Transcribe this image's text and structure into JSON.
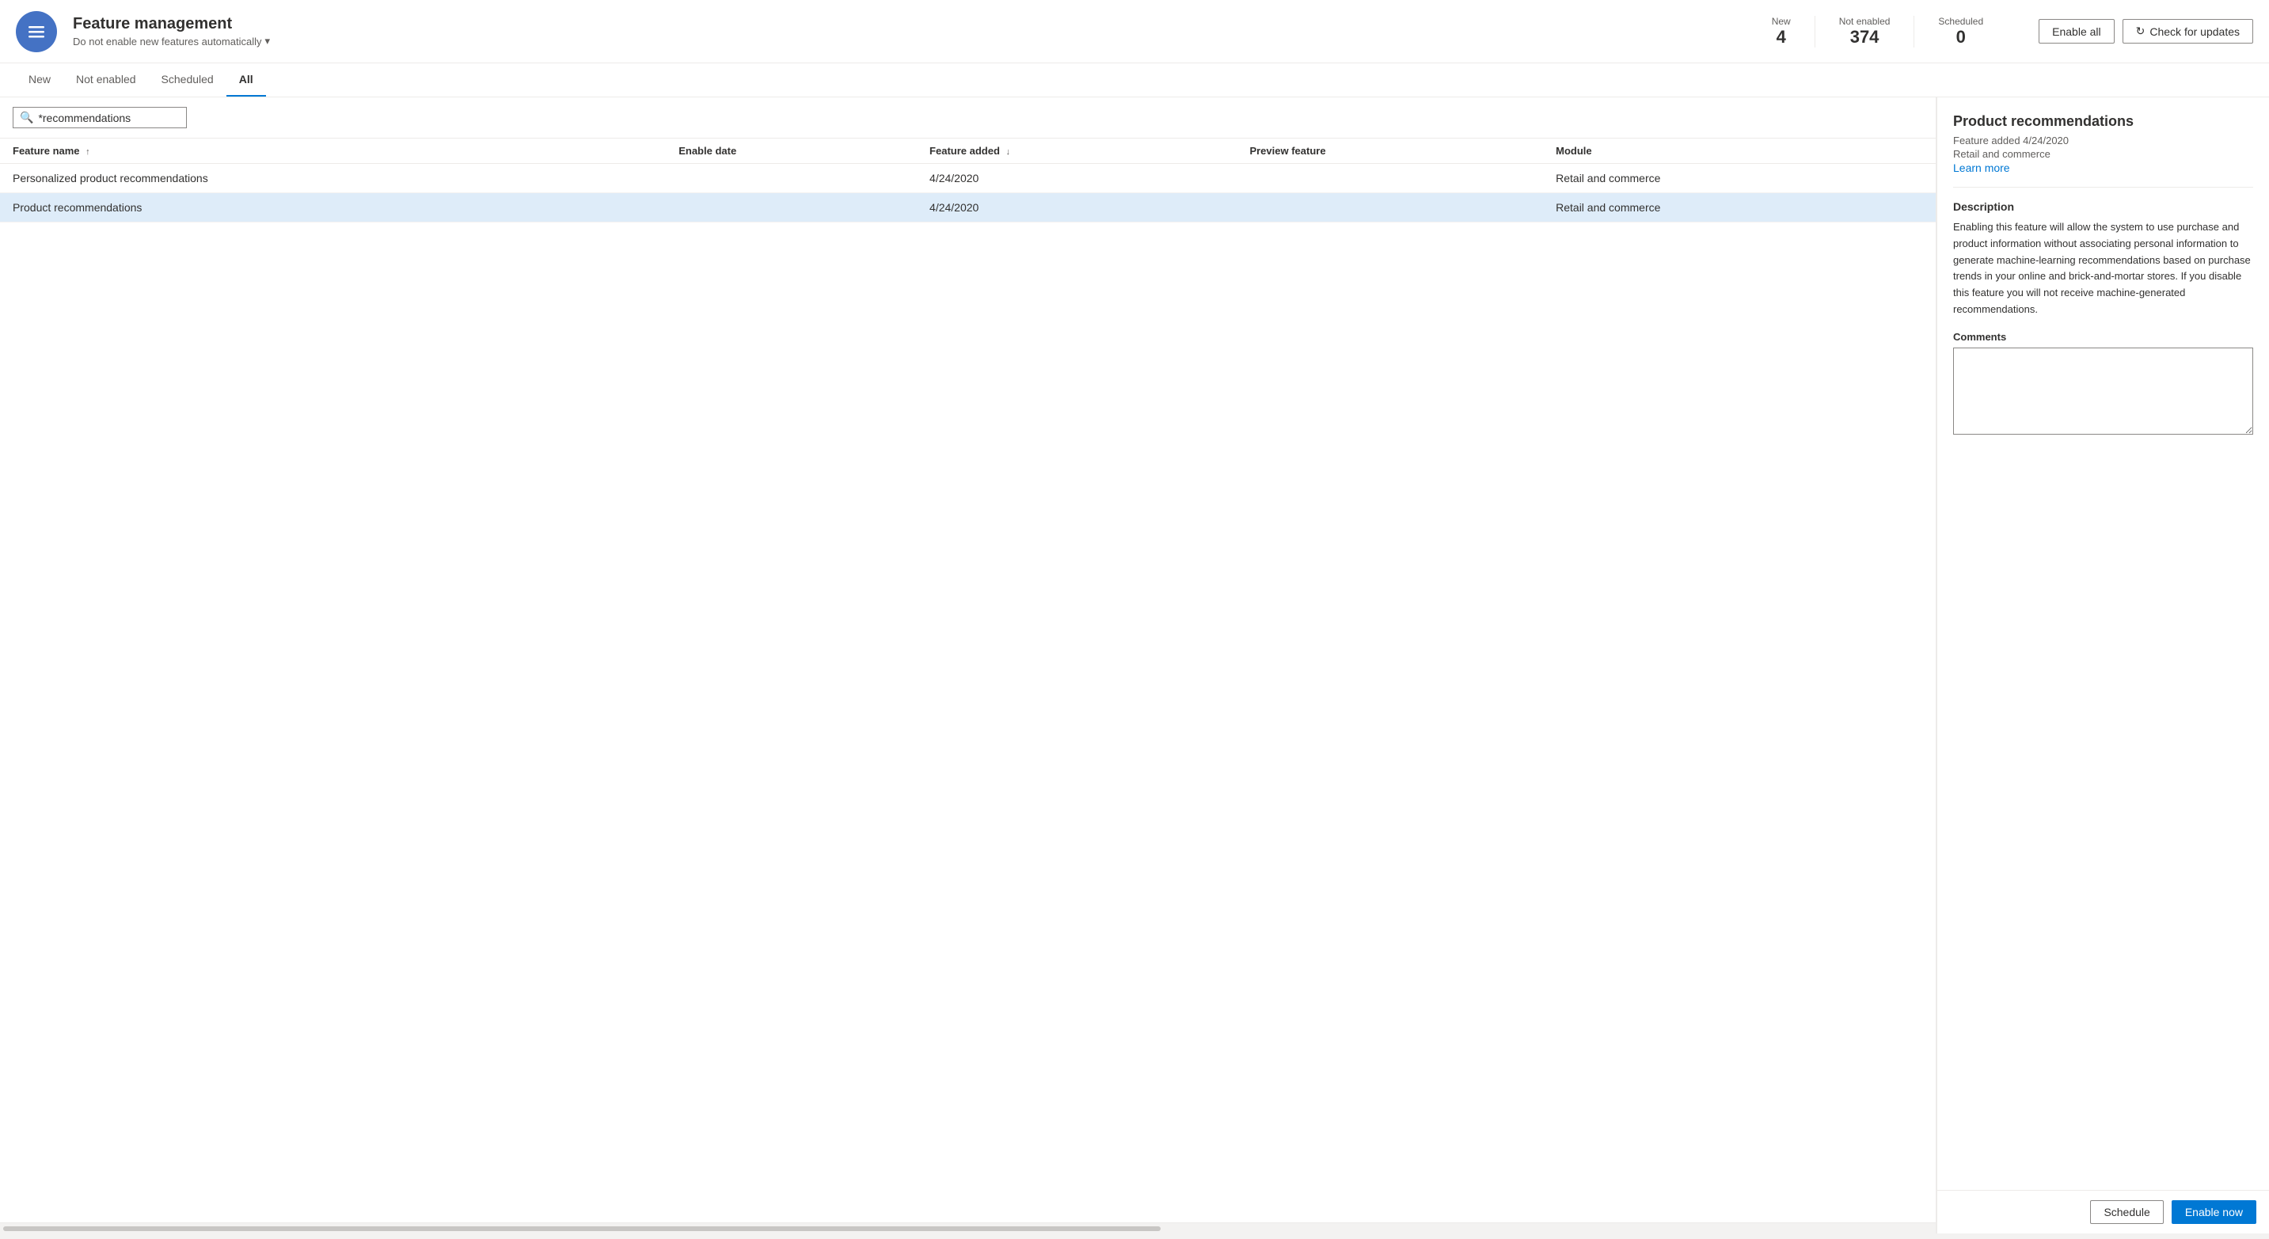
{
  "header": {
    "title": "Feature management",
    "subtitle": "Do not enable new features automatically",
    "subtitle_chevron": "▾",
    "stats": [
      {
        "label": "New",
        "value": "4"
      },
      {
        "label": "Not enabled",
        "value": "374"
      },
      {
        "label": "Scheduled",
        "value": "0"
      }
    ],
    "enable_all_label": "Enable all",
    "check_updates_label": "Check for updates"
  },
  "tabs": [
    {
      "label": "New",
      "active": false
    },
    {
      "label": "Not enabled",
      "active": false
    },
    {
      "label": "Scheduled",
      "active": false
    },
    {
      "label": "All",
      "active": true
    }
  ],
  "search": {
    "placeholder": "Search",
    "value": "*recommendations"
  },
  "table": {
    "columns": [
      {
        "label": "Feature name",
        "sort": "asc"
      },
      {
        "label": "Enable date",
        "sort": null
      },
      {
        "label": "Feature added",
        "sort": "desc"
      },
      {
        "label": "Preview feature",
        "sort": null
      },
      {
        "label": "Module",
        "sort": null
      }
    ],
    "rows": [
      {
        "feature_name": "Personalized product recommendations",
        "enable_date": "",
        "feature_added": "4/24/2020",
        "preview_feature": "",
        "module": "Retail and commerce",
        "selected": false
      },
      {
        "feature_name": "Product recommendations",
        "enable_date": "",
        "feature_added": "4/24/2020",
        "preview_feature": "",
        "module": "Retail and commerce",
        "selected": true
      }
    ]
  },
  "detail": {
    "title": "Product recommendations",
    "feature_added_label": "Feature added 4/24/2020",
    "module_label": "Retail and commerce",
    "learn_more_label": "Learn more",
    "description_title": "Description",
    "description": "Enabling this feature will allow the system to use purchase and product information without associating personal information to generate machine-learning recommendations based on purchase trends in your online and brick-and-mortar stores. If you disable this feature you will not receive machine-generated recommendations.",
    "comments_label": "Comments",
    "comments_value": "",
    "schedule_label": "Schedule",
    "enable_now_label": "Enable now"
  }
}
